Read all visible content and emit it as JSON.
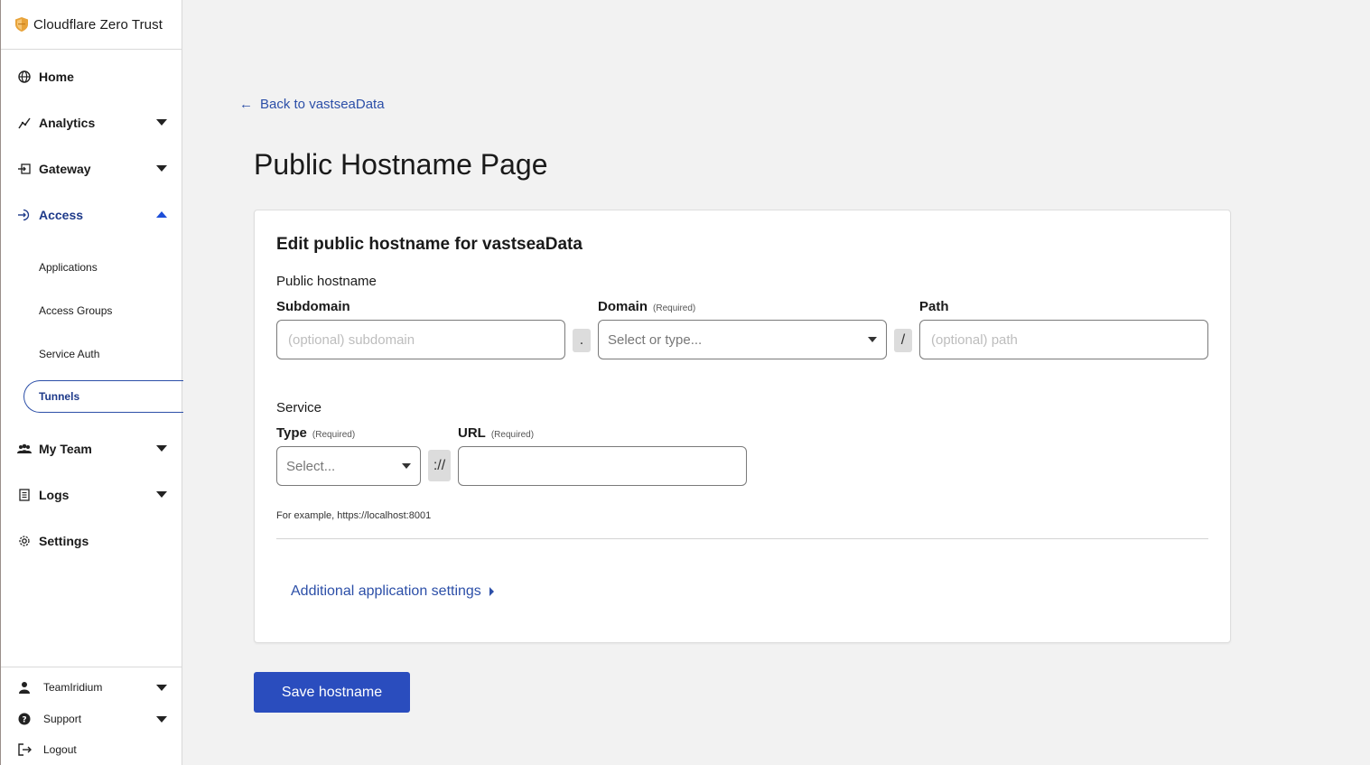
{
  "brand": {
    "name": "Cloudflare Zero Trust",
    "logo_icon": "shield-logo-icon",
    "logo_color": "#e8a33a"
  },
  "nav": {
    "items": [
      {
        "label": "Home",
        "icon": "globe-icon"
      },
      {
        "label": "Analytics",
        "icon": "chart-line-icon"
      },
      {
        "label": "Gateway",
        "icon": "gateway-icon"
      },
      {
        "label": "Access",
        "icon": "access-icon"
      },
      {
        "label": "My Team",
        "icon": "team-icon"
      },
      {
        "label": "Logs",
        "icon": "logs-icon"
      },
      {
        "label": "Settings",
        "icon": "gear-icon"
      }
    ],
    "access_sub": [
      "Applications",
      "Access Groups",
      "Service Auth",
      "Tunnels"
    ]
  },
  "bottom": {
    "account": "TeamIridium",
    "support": "Support",
    "logout": "Logout"
  },
  "main": {
    "back_arrow": "←",
    "back_label": "Back to vastseaData",
    "page_title": "Public Hostname Page",
    "card_title": "Edit public hostname for vastseaData",
    "public_hostname_label": "Public hostname",
    "subdomain_label": "Subdomain",
    "subdomain_placeholder": "(optional) subdomain",
    "dot_sep": ".",
    "domain_label": "Domain",
    "required": "(Required)",
    "domain_placeholder": "Select or type...",
    "slash_sep": "/",
    "path_label": "Path",
    "path_placeholder": "(optional) path",
    "service_label": "Service",
    "type_label": "Type",
    "type_placeholder": "Select...",
    "scheme_sep": "://",
    "url_label": "URL",
    "url_value": "",
    "help_text": "For example, https://localhost:8001",
    "more_settings": "Additional application settings",
    "save_label": "Save hostname"
  },
  "colors": {
    "accent": "#2a4dbe",
    "link": "#2c4fa8",
    "active_nav": "#1e3a8a"
  }
}
